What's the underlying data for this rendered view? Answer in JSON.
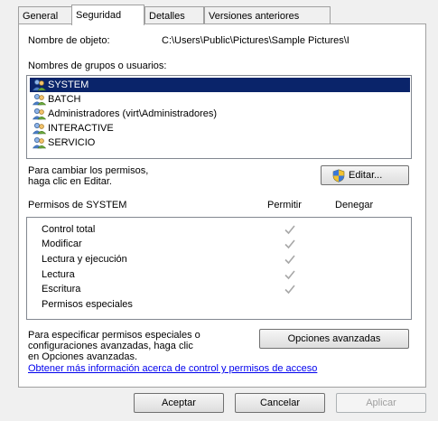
{
  "tabs": [
    {
      "label": "General"
    },
    {
      "label": "Seguridad"
    },
    {
      "label": "Detalles"
    },
    {
      "label": "Versiones anteriores"
    }
  ],
  "object": {
    "label": "Nombre de objeto:",
    "value": "C:\\Users\\Public\\Pictures\\Sample Pictures\\I"
  },
  "groups": {
    "label": "Nombres de grupos o usuarios:",
    "items": [
      {
        "name": "SYSTEM"
      },
      {
        "name": "BATCH"
      },
      {
        "name": "Administradores (virt\\Administradores)"
      },
      {
        "name": "INTERACTIVE"
      },
      {
        "name": "SERVICIO"
      }
    ],
    "selected_index": 0
  },
  "change": {
    "line1": "Para cambiar los permisos,",
    "line2": "haga clic en Editar.",
    "edit_button": "Editar..."
  },
  "permissions": {
    "header_label": "Permisos de SYSTEM",
    "allow_label": "Permitir",
    "deny_label": "Denegar",
    "rows": [
      {
        "name": "Control total",
        "allow": true
      },
      {
        "name": "Modificar",
        "allow": true
      },
      {
        "name": "Lectura y ejecución",
        "allow": true
      },
      {
        "name": "Lectura",
        "allow": true
      },
      {
        "name": "Escritura",
        "allow": true
      },
      {
        "name": "Permisos especiales",
        "allow": false
      }
    ]
  },
  "advanced": {
    "line1": "Para especificar permisos especiales o",
    "line2": "configuraciones avanzadas, haga clic",
    "line3": "en Opciones avanzadas.",
    "button": "Opciones avanzadas",
    "link": "Obtener más información acerca de control y permisos de acceso"
  },
  "footer": {
    "ok": "Aceptar",
    "cancel": "Cancelar",
    "apply": "Aplicar"
  },
  "colors": {
    "selection": "#0a246a",
    "link": "#0000ee",
    "check": "#a8a8a8",
    "disabled_text": "#a0a0a0"
  }
}
